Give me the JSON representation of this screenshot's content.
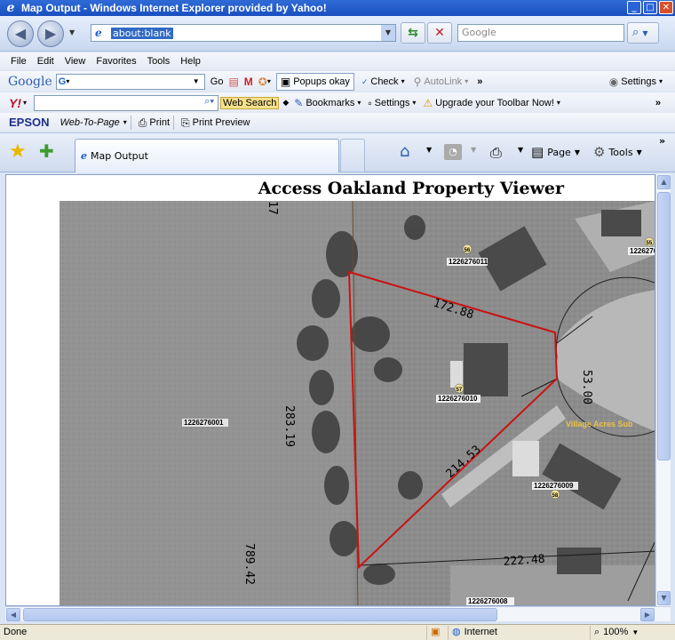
{
  "window": {
    "title": "Map Output - Windows Internet Explorer provided by Yahoo!"
  },
  "address": {
    "url": "about:blank",
    "search_placeholder": "Google"
  },
  "menu": [
    "File",
    "Edit",
    "View",
    "Favorites",
    "Tools",
    "Help"
  ],
  "google_bar": {
    "logo": "Google",
    "go": "Go",
    "popups": "Popups okay",
    "check": "Check",
    "autolink": "AutoLink",
    "settings": "Settings"
  },
  "yahoo_bar": {
    "logo": "Y!",
    "web_search": "Web Search",
    "bookmarks": "Bookmarks",
    "settings": "Settings",
    "upgrade": "Upgrade your Toolbar Now!"
  },
  "epson_bar": {
    "logo": "EPSON",
    "web_to_page": "Web-To-Page",
    "print": "Print",
    "print_preview": "Print Preview"
  },
  "tab": {
    "label": "Map Output"
  },
  "command_bar": {
    "page": "Page",
    "tools": "Tools"
  },
  "page": {
    "title": "Access Oakland Property Viewer"
  },
  "map": {
    "parcels": [
      {
        "id": "1226276011",
        "num": "56"
      },
      {
        "id": "1226276010",
        "num": "57"
      },
      {
        "id": "1226276009",
        "num": "58"
      },
      {
        "id": "1226276001",
        "num": ""
      },
      {
        "id": "1226276008",
        "num": ""
      },
      {
        "id": "",
        "num": "55"
      }
    ],
    "parcel_extra": "1226276",
    "dimensions": [
      "172.88",
      "283.19",
      "53.00",
      "214.53",
      "222.48",
      "789.42",
      "17"
    ],
    "subdivision": "Village Acres Sub"
  },
  "status": {
    "left": "Done",
    "zone": "Internet",
    "zoom": "100%"
  },
  "colors": {
    "boundary": "#cc1111",
    "subdivision_label": "#e8c24a",
    "titlebar": "#1f59c9"
  }
}
